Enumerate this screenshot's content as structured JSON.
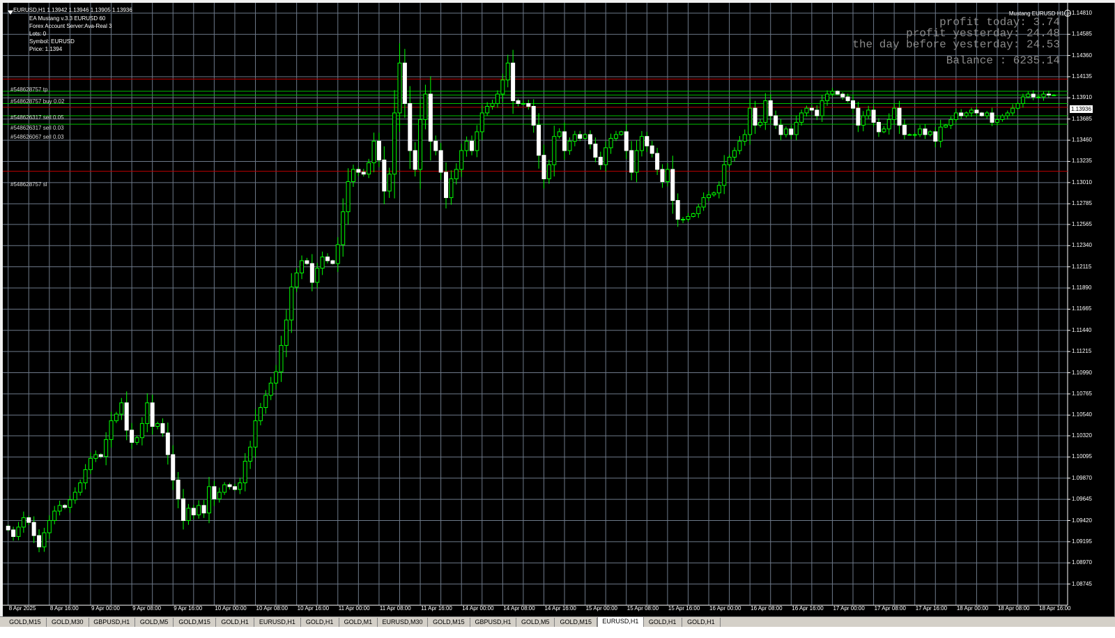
{
  "window": {
    "header": "EURUSD,H1  1.13942 1.13946 1.13905 1.13936",
    "ea_name": "EA Mustang v.3.3 EURUSD  60",
    "account": "Forex Account Server:Ava-Real 3",
    "lots": "Lots:  0",
    "symbol": "Symbol: EURUSD",
    "price": "Price:  1.1394",
    "expert_label": "Mustang EURUSD H1",
    "current_price": "1.13936"
  },
  "profit_panel": {
    "today": "profit today: 3.74",
    "yesterday": "profit yesterday: 24.48",
    "day_before": "the day before yesterday: 24.53",
    "balance": "Balance : 6235.14"
  },
  "order_labels": [
    "#548628757 tp",
    "#548628757 buy 0.02",
    "#548626317 sell 0.05",
    "#548626317 sell 0.03",
    "#548626067 sell 0.03",
    "#548628757 sl"
  ],
  "tabs": [
    "GOLD,M15",
    "GOLD,M30",
    "GBPUSD,H1",
    "GOLD,M5",
    "GOLD,M15",
    "GOLD,H1",
    "EURUSD,H1",
    "GOLD,H1",
    "GOLD,M1",
    "EURUSD,M30",
    "GOLD,M15",
    "GBPUSD,H1",
    "GOLD,M5",
    "GOLD,M15",
    "EURUSD,H1",
    "GOLD,H1",
    "GOLD,H1"
  ],
  "active_tab_index": 14,
  "colors": {
    "background": "#000000",
    "grid": "#6e7a8a",
    "bull": "#00ff00",
    "bear": "#ffffff",
    "tp_line": "#c00000",
    "order_line": "#00c000",
    "text": "#ffffff"
  },
  "chart_data": {
    "type": "candlestick",
    "symbol": "EURUSD",
    "timeframe": "H1",
    "ylim": [
      1.0852,
      1.1492
    ],
    "price_ticks": [
      "1.14810",
      "1.14585",
      "1.14360",
      "1.14135",
      "1.13910",
      "1.13685",
      "1.13460",
      "1.13235",
      "1.13010",
      "1.12785",
      "1.12565",
      "1.12340",
      "1.12115",
      "1.11890",
      "1.11665",
      "1.11440",
      "1.11215",
      "1.10990",
      "1.10765",
      "1.10540",
      "1.10320",
      "1.10095",
      "1.09870",
      "1.09645",
      "1.09420",
      "1.09195",
      "1.08970",
      "1.08745"
    ],
    "time_ticks": [
      "8 Apr 2025",
      "8 Apr 16:00",
      "9 Apr 00:00",
      "9 Apr 08:00",
      "9 Apr 16:00",
      "10 Apr 00:00",
      "10 Apr 08:00",
      "10 Apr 16:00",
      "11 Apr 00:00",
      "11 Apr 08:00",
      "11 Apr 16:00",
      "14 Apr 00:00",
      "14 Apr 08:00",
      "14 Apr 16:00",
      "15 Apr 00:00",
      "15 Apr 08:00",
      "15 Apr 16:00",
      "16 Apr 00:00",
      "16 Apr 08:00",
      "16 Apr 16:00",
      "17 Apr 00:00",
      "17 Apr 08:00",
      "17 Apr 16:00",
      "18 Apr 00:00",
      "18 Apr 08:00",
      "18 Apr 16:00"
    ],
    "bars_per_tick": 8,
    "levels": [
      {
        "label": "#548628757 tp",
        "price": 1.1411,
        "color": "#c00000"
      },
      {
        "label": "#548628757 buy 0.02",
        "price": 1.1398,
        "color": "#00c000"
      },
      {
        "label": "",
        "price": 1.1394,
        "color": "#00c000"
      },
      {
        "label": "#548626317 sell 0.05",
        "price": 1.1385,
        "color": "#00c000"
      },
      {
        "label": "",
        "price": 1.1381,
        "color": "#c00000"
      },
      {
        "label": "#548626317 sell 0.03",
        "price": 1.1372,
        "color": "#00c000"
      },
      {
        "label": "#548626067 sell 0.03",
        "price": 1.1363,
        "color": "#00c000"
      },
      {
        "label": "#548628757 sl",
        "price": 1.1313,
        "color": "#c00000"
      }
    ],
    "closes": [
      1.0932,
      1.0925,
      1.0935,
      1.0945,
      1.094,
      1.0926,
      1.0914,
      1.0929,
      1.0942,
      1.0952,
      1.0958,
      1.0956,
      1.0964,
      1.0972,
      1.0982,
      1.0996,
      1.1008,
      1.1012,
      1.101,
      1.1028,
      1.1048,
      1.1055,
      1.1067,
      1.1038,
      1.1025,
      1.103,
      1.1045,
      1.1067,
      1.1042,
      1.1045,
      1.1035,
      1.1012,
      1.0985,
      1.0965,
      1.0942,
      1.0955,
      1.0948,
      1.0958,
      1.095,
      1.0978,
      1.0965,
      1.0972,
      1.098,
      1.0978,
      1.0975,
      1.0982,
      1.1005,
      1.102,
      1.1048,
      1.1062,
      1.1075,
      1.1088,
      1.11,
      1.1128,
      1.1155,
      1.119,
      1.1205,
      1.1218,
      1.1215,
      1.1195,
      1.121,
      1.1222,
      1.1218,
      1.1215,
      1.1235,
      1.127,
      1.1302,
      1.1315,
      1.1312,
      1.131,
      1.1322,
      1.1345,
      1.1325,
      1.1292,
      1.131,
      1.1375,
      1.1428,
      1.1385,
      1.1335,
      1.1315,
      1.1368,
      1.1395,
      1.1345,
      1.1335,
      1.1312,
      1.1285,
      1.1305,
      1.1315,
      1.1335,
      1.1345,
      1.1335,
      1.1355,
      1.1375,
      1.1382,
      1.1385,
      1.1395,
      1.141,
      1.1428,
      1.1388,
      1.1385,
      1.1385,
      1.1382,
      1.1362,
      1.133,
      1.1305,
      1.132,
      1.135,
      1.1355,
      1.1335,
      1.1345,
      1.1352,
      1.1348,
      1.1352,
      1.1342,
      1.1328,
      1.132,
      1.1338,
      1.1348,
      1.1352,
      1.1355,
      1.1335,
      1.1312,
      1.1335,
      1.135,
      1.134,
      1.1332,
      1.1315,
      1.1302,
      1.1315,
      1.1282,
      1.1262,
      1.1262,
      1.1265,
      1.1268,
      1.1275,
      1.1285,
      1.1288,
      1.129,
      1.1298,
      1.132,
      1.1328,
      1.1335,
      1.1345,
      1.1352,
      1.138,
      1.1362,
      1.1365,
      1.1388,
      1.1372,
      1.1362,
      1.1352,
      1.1358,
      1.1352,
      1.1365,
      1.1375,
      1.138,
      1.1378,
      1.1372,
      1.1388,
      1.1395,
      1.1398,
      1.1395,
      1.1392,
      1.1388,
      1.138,
      1.1362,
      1.1372,
      1.1378,
      1.1365,
      1.1355,
      1.1358,
      1.1368,
      1.138,
      1.1362,
      1.1352,
      1.1352,
      1.1352,
      1.1358,
      1.1352,
      1.1355,
      1.1345,
      1.136,
      1.1362,
      1.1368,
      1.1375,
      1.1372,
      1.1375,
      1.1378,
      1.1375,
      1.1372,
      1.1375,
      1.1365,
      1.1368,
      1.1372,
      1.1375,
      1.138,
      1.1385,
      1.1392,
      1.1395,
      1.1392,
      1.1392,
      1.1395,
      1.1394,
      1.1394
    ]
  }
}
